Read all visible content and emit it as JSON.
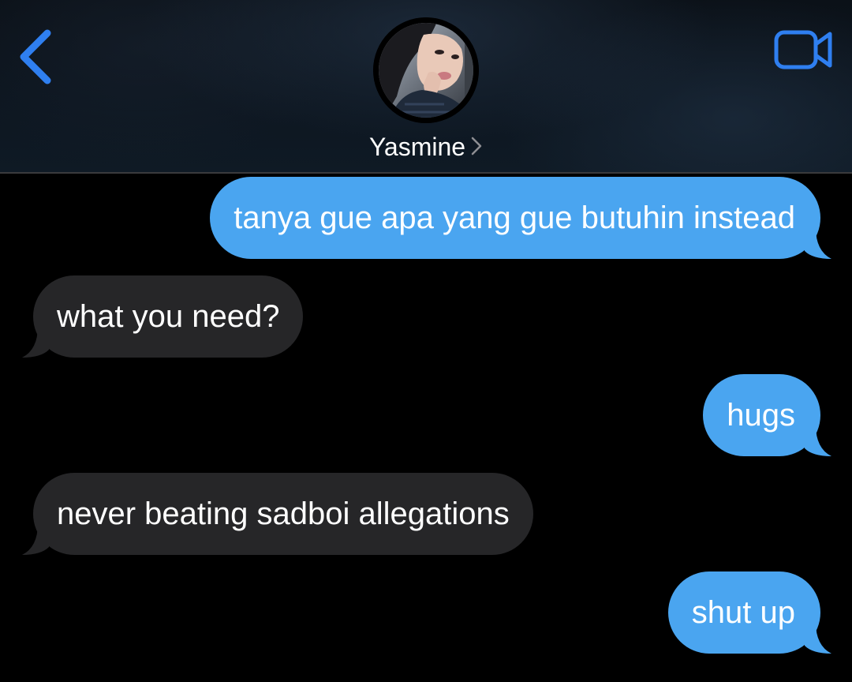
{
  "header": {
    "contact_name": "Yasmine",
    "back_icon": "chevron-left-icon",
    "video_icon": "video-camera-icon",
    "accent_color": "#2f7ff0"
  },
  "messages": [
    {
      "direction": "sent",
      "text": "tanya gue apa yang gue butuhin instead"
    },
    {
      "direction": "received",
      "text": "what you need?"
    },
    {
      "direction": "sent",
      "text": "hugs"
    },
    {
      "direction": "received",
      "text": "never beating sadboi allegations"
    },
    {
      "direction": "sent",
      "text": "shut up"
    }
  ],
  "colors": {
    "sent_bubble": "#4aa5f0",
    "received_bubble": "#262628",
    "background": "#000000"
  }
}
